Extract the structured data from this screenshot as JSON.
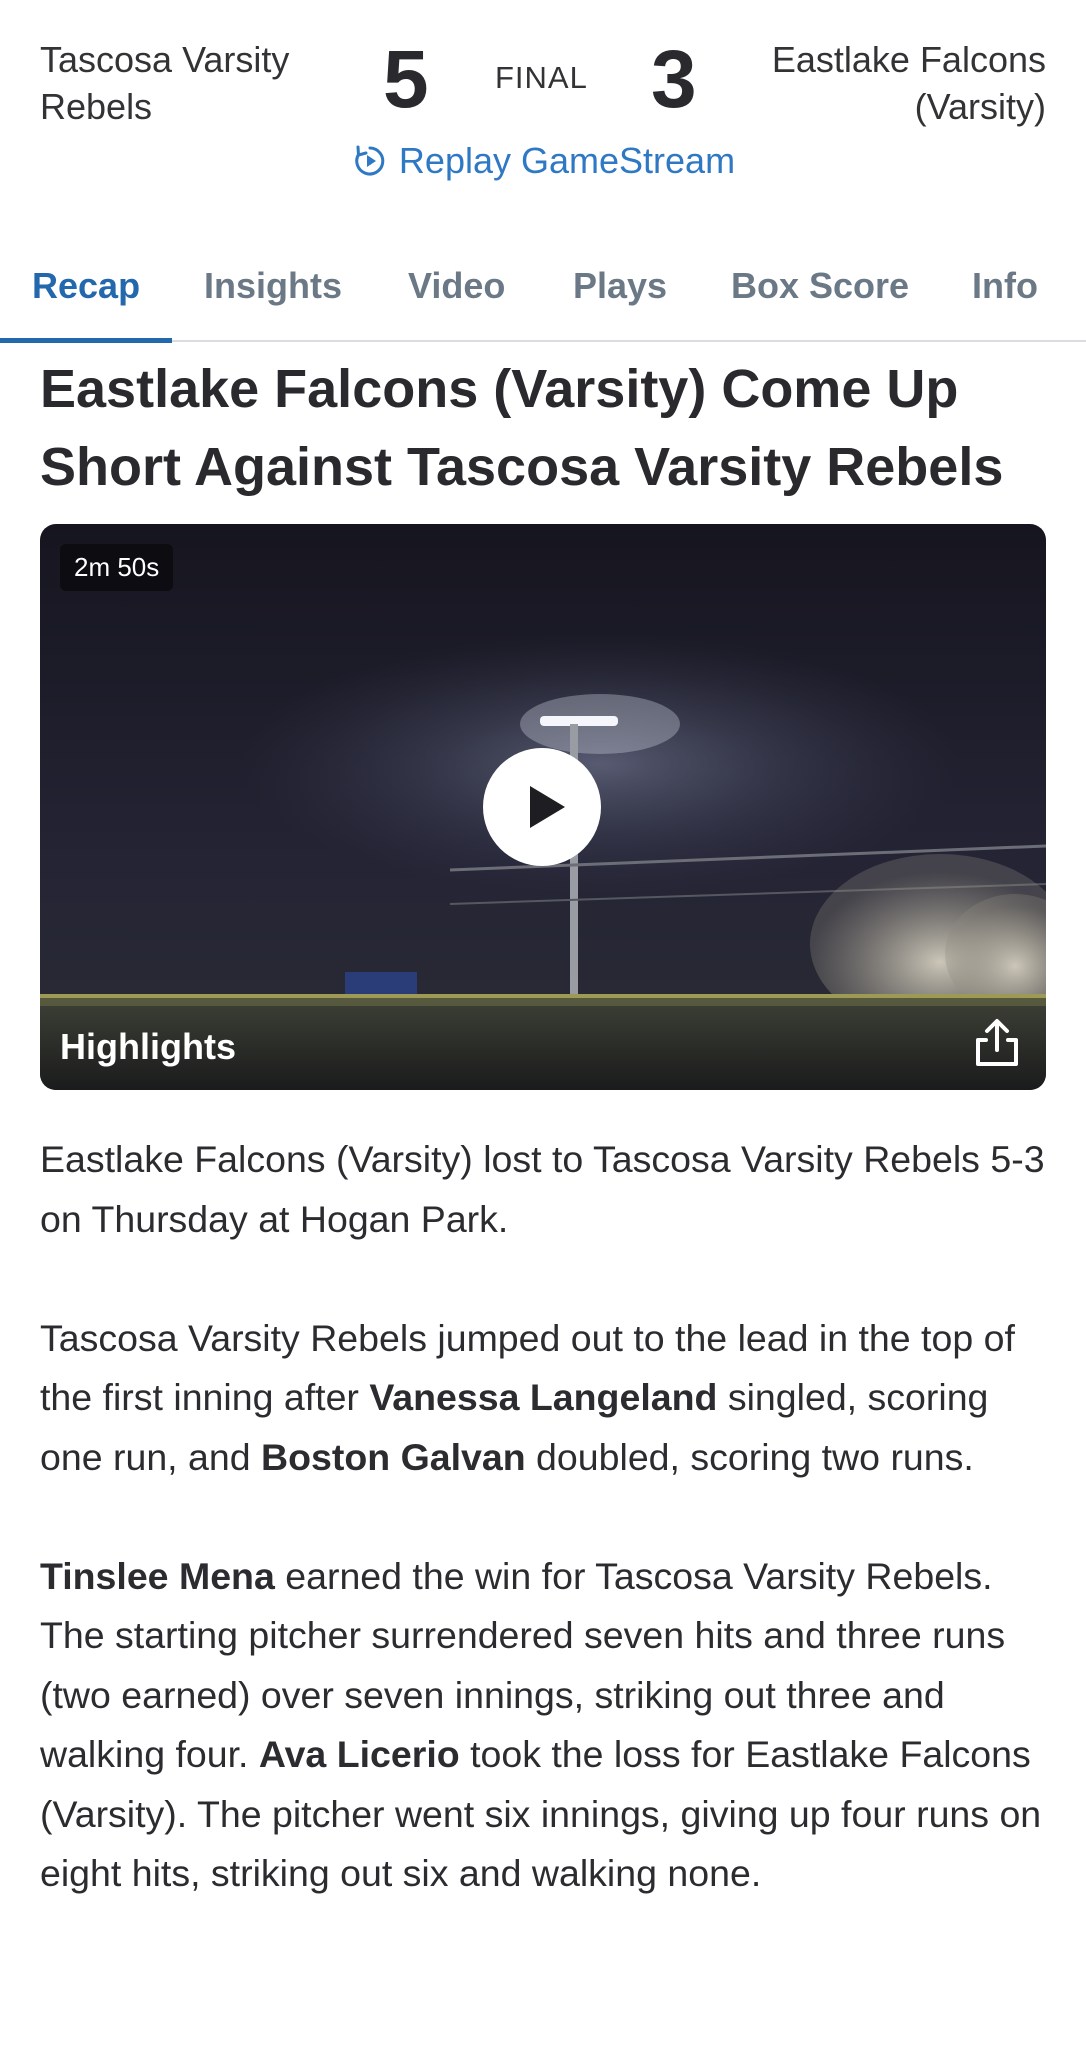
{
  "game": {
    "home_team": "Tascosa Varsity Rebels",
    "home_score": "5",
    "status": "FINAL",
    "away_score": "3",
    "away_team": "Eastlake Falcons (Varsity)",
    "replay_label": "Replay GameStream"
  },
  "tabs": [
    {
      "label": "Recap",
      "active": true
    },
    {
      "label": "Insights",
      "active": false
    },
    {
      "label": "Video",
      "active": false
    },
    {
      "label": "Plays",
      "active": false
    },
    {
      "label": "Box Score",
      "active": false
    },
    {
      "label": "Info",
      "active": false
    }
  ],
  "recap": {
    "headline": "Eastlake Falcons (Varsity) Come Up Short Against Tascosa Varsity Rebels",
    "video": {
      "duration": "2m 50s",
      "label": "Highlights"
    },
    "paragraphs": [
      {
        "p1": "Eastlake Falcons (Varsity) lost to Tascosa Varsity Rebels 5-3 on Thursday at Hogan Park."
      },
      {
        "t1": "Tascosa Varsity Rebels jumped out to the lead in the top of the first inning after ",
        "b1": "Vanessa Langeland",
        "t2": " singled, scoring one run, and ",
        "b2": "Boston Galvan",
        "t3": " doubled, scoring two runs."
      },
      {
        "b1": "Tinslee Mena",
        "t1": " earned the win for Tascosa Varsity Rebels. The starting pitcher surrendered seven hits and three runs (two earned) over seven innings, striking out three and walking four. ",
        "b2": "Ava Licerio",
        "t2": " took the loss for Eastlake Falcons (Varsity). The pitcher went six innings, giving up four runs on eight hits, striking out six and walking none."
      }
    ]
  },
  "colors": {
    "accent": "#2367ad",
    "link": "#2f78c4",
    "tab_inactive": "#6b7885"
  }
}
